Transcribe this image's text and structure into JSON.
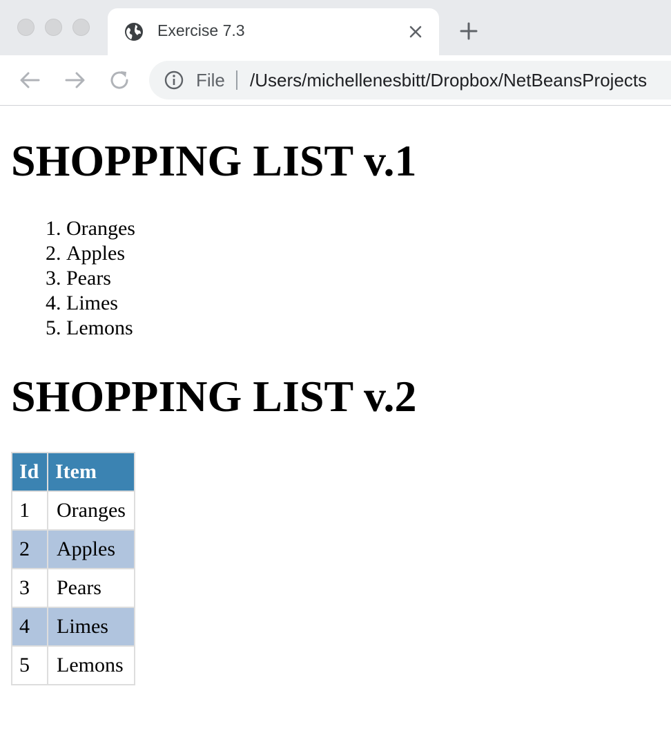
{
  "browser": {
    "tab_title": "Exercise 7.3",
    "scheme_label": "File",
    "url": "/Users/michellenesbitt/Dropbox/NetBeansProjects"
  },
  "icons": {
    "tab_favicon": "globe-icon",
    "tab_close": "close-icon",
    "new_tab": "plus-icon",
    "back": "arrow-left-icon",
    "forward": "arrow-right-icon",
    "reload": "reload-icon",
    "info": "info-icon"
  },
  "colors": {
    "table_header_bg": "#3b83b2",
    "table_even_row_bg": "#b0c4de",
    "table_border": "#dddddd"
  },
  "page": {
    "heading1": "SHOPPING LIST v.1",
    "ordered_list": [
      "Oranges",
      "Apples",
      "Pears",
      "Limes",
      "Lemons"
    ],
    "heading2": "SHOPPING LIST v.2",
    "table": {
      "headers": [
        "Id",
        "Item"
      ],
      "rows": [
        [
          "1",
          "Oranges"
        ],
        [
          "2",
          "Apples"
        ],
        [
          "3",
          "Pears"
        ],
        [
          "4",
          "Limes"
        ],
        [
          "5",
          "Lemons"
        ]
      ]
    }
  }
}
